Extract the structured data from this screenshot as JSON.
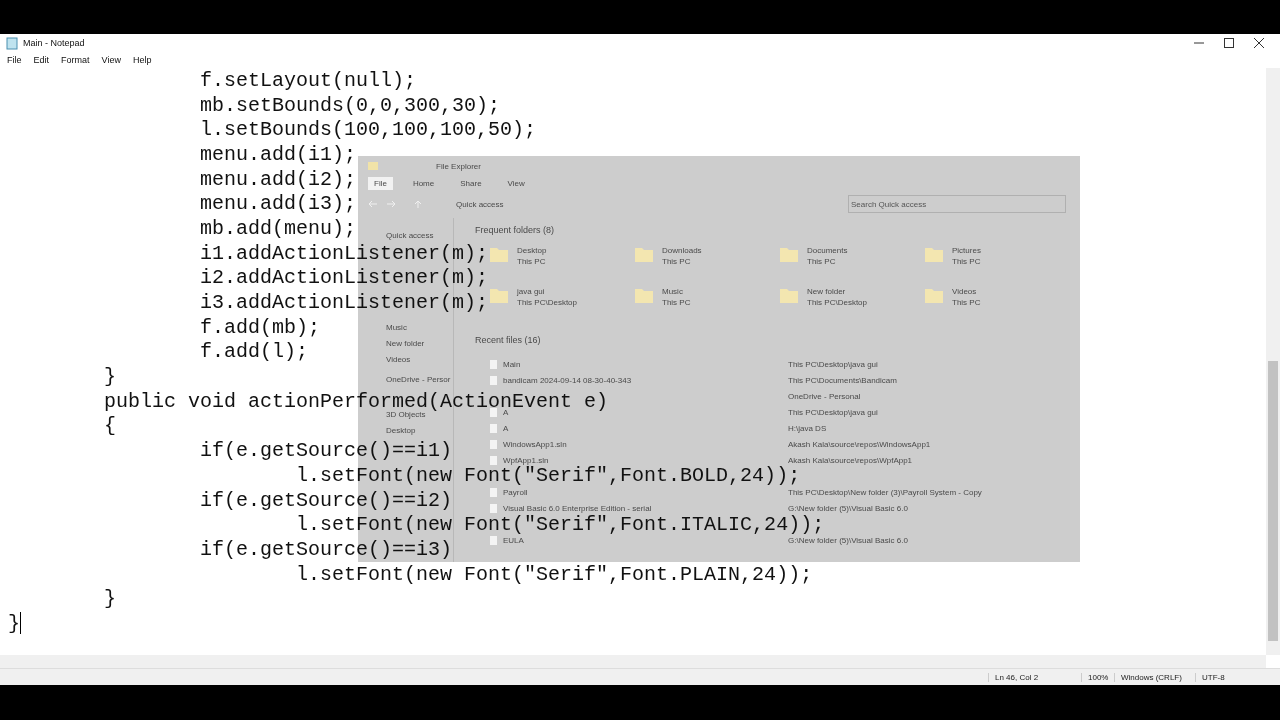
{
  "window": {
    "title": "Main - Notepad"
  },
  "menu": [
    "File",
    "Edit",
    "Format",
    "View",
    "Help"
  ],
  "editor": {
    "lines": [
      {
        "text": "                f.setLayout(null);"
      },
      {
        "text": "                mb.setBounds(0,0,300,30);"
      },
      {
        "text": "                l.setBounds(100,100,100,50);"
      },
      {
        "text": "                menu.add(i1);"
      },
      {
        "text": "                menu.add(i2);"
      },
      {
        "text": "                menu.add(i3);"
      },
      {
        "text": "                mb.add(menu);"
      },
      {
        "text": "                i1.addActionListener(m);"
      },
      {
        "text": "                i2.addActionListener(m);"
      },
      {
        "text": "                i3.addActionListener(m);"
      },
      {
        "text": "                f.add(mb);"
      },
      {
        "text": "                f.add(l);"
      },
      {
        "text": "        }"
      },
      {
        "text": "        public void actionPerformed(ActionEvent e)"
      },
      {
        "text": "        {"
      },
      {
        "text": "                if(e.getSource()==i1)"
      },
      {
        "text": "                        l.setFont(new Font(\"Serif\",Font.BOLD,24));"
      },
      {
        "text": "                if(e.getSource()==i2)"
      },
      {
        "text": "                        l.setFont(new Font(\"Serif\",Font.ITALIC,24));"
      },
      {
        "text": "                if(e.getSource()==i3)"
      },
      {
        "text": "                        l.setFont(new Font(\"Serif\",Font.PLAIN,24));"
      },
      {
        "text": "        }"
      },
      {
        "text": "}",
        "caret": true
      }
    ]
  },
  "status_bar": [
    "Ln 46, Col 2",
    "100%",
    "Windows (CRLF)",
    "UTF-8"
  ],
  "faded_explorer": {
    "title": "File Explorer",
    "ribbon_tabs": [
      {
        "label": "File",
        "selected": true
      },
      {
        "label": "Home",
        "selected": false
      },
      {
        "label": "Share",
        "selected": false
      },
      {
        "label": "View",
        "selected": false
      }
    ],
    "address": "Quick access",
    "search": {
      "placeholder": "Search Quick access"
    },
    "sidebar": [
      "Quick access",
      "Music",
      "New folder",
      "Videos",
      "OneDrive - Persor",
      "3D Objects",
      "Desktop"
    ],
    "frequent_header": "Frequent folders (8)",
    "folders": [
      {
        "name": "Desktop",
        "location": "This PC"
      },
      {
        "name": "Downloads",
        "location": "This PC"
      },
      {
        "name": "Documents",
        "location": "This PC"
      },
      {
        "name": "Pictures",
        "location": "This PC"
      },
      {
        "name": "java gui",
        "location": "This PC\\Desktop"
      },
      {
        "name": "Music",
        "location": "This PC"
      },
      {
        "name": "New folder",
        "location": "This PC\\Desktop"
      },
      {
        "name": "Videos",
        "location": "This PC"
      }
    ],
    "recent_header": "Recent files (16)",
    "recent_files": [
      {
        "name": "Main",
        "path": "This PC\\Desktop\\java gui"
      },
      {
        "name": "bandicam 2024-09-14 08-30-40-343",
        "path": "This PC\\Documents\\Bandicam"
      },
      {
        "path": "OneDrive - Personal"
      },
      {
        "name": "A",
        "path": "This PC\\Desktop\\java gui"
      },
      {
        "name": "A",
        "path": "H:\\java DS"
      },
      {
        "name": "WindowsApp1.sln",
        "path": "Akash Kala\\source\\repos\\WindowsApp1"
      },
      {
        "name": "WpfApp1.sln",
        "path": "Akash Kala\\source\\repos\\WpfApp1"
      },
      {
        "kind": "covered"
      },
      {
        "name": "Payroll",
        "path": "This PC\\Desktop\\New folder (3)\\Payroll System - Copy"
      },
      {
        "name": "Visual Basic 6.0 Enterprise Edition - serial",
        "path": "G:\\New folder (5)\\Visual Basic 6.0"
      },
      {
        "kind": "covered"
      },
      {
        "name": "EULA",
        "path": "G:\\New folder (5)\\Visual Basic 6.0"
      }
    ]
  }
}
